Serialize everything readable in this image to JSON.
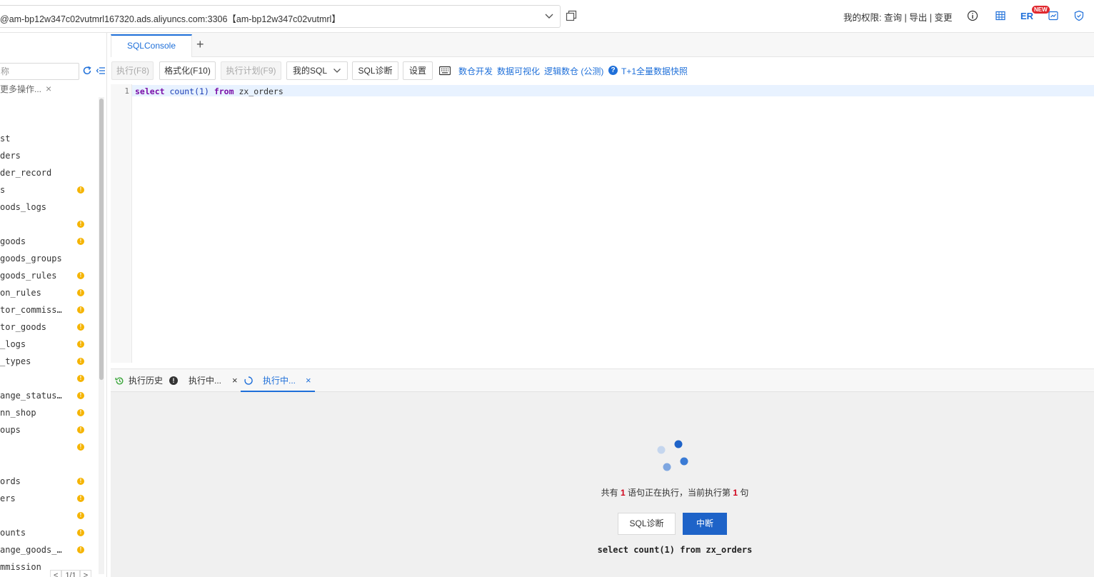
{
  "topbar": {
    "connection": "@am-bp12w347c02vutmrl167320.ads.aliyuncs.com:3306【am-bp12w347c02vutmrl】",
    "permissions_label": "我的权限:",
    "perm_query": "查询",
    "perm_export": "导出",
    "perm_change": "变更",
    "sep": "|",
    "er_label": "ER",
    "new_badge": "NEW"
  },
  "sidebar": {
    "search_placeholder": "称",
    "more_ops": "更多操作...",
    "close": "×",
    "tables": [
      {
        "name": "st",
        "warn": false
      },
      {
        "name": "ders",
        "warn": false
      },
      {
        "name": "der_record",
        "warn": false
      },
      {
        "name": "s",
        "warn": true
      },
      {
        "name": "oods_logs",
        "warn": false
      },
      {
        "name": "",
        "warn": true
      },
      {
        "name": "goods",
        "warn": true
      },
      {
        "name": "goods_groups",
        "warn": false
      },
      {
        "name": "goods_rules",
        "warn": true
      },
      {
        "name": "on_rules",
        "warn": true
      },
      {
        "name": "tor_commiss…",
        "warn": true
      },
      {
        "name": "tor_goods",
        "warn": true
      },
      {
        "name": "_logs",
        "warn": true
      },
      {
        "name": "_types",
        "warn": true
      },
      {
        "name": "",
        "warn": true
      },
      {
        "name": "ange_status…",
        "warn": true
      },
      {
        "name": "nn_shop",
        "warn": true
      },
      {
        "name": "oups",
        "warn": true
      },
      {
        "name": "",
        "warn": true
      },
      {
        "name": "",
        "warn": false
      },
      {
        "name": "ords",
        "warn": true
      },
      {
        "name": "ers",
        "warn": true
      },
      {
        "name": "",
        "warn": true
      },
      {
        "name": "ounts",
        "warn": true
      },
      {
        "name": "ange_goods_…",
        "warn": true
      },
      {
        "name": "mmission",
        "warn": false
      }
    ],
    "pager": {
      "prev": "<",
      "page": "1/1",
      "next": ">"
    }
  },
  "tabs": {
    "sql_console": "SQLConsole",
    "add": "+"
  },
  "toolbar": {
    "execute": "执行(F8)",
    "format": "格式化(F10)",
    "plan": "执行计划(F9)",
    "my_sql": "我的SQL",
    "diagnose": "SQL诊断",
    "settings": "设置",
    "link_dw": "数仓开发",
    "link_vis": "数据可视化",
    "link_logic": "逻辑数仓 (公测)",
    "link_snapshot": "T+1全量数据快照"
  },
  "editor": {
    "line_number": "1",
    "kw_select": "select",
    "fn_count": "count(1)",
    "kw_from": "from",
    "table": "zx_orders"
  },
  "results": {
    "history_tab": "执行历史",
    "history_alert": "!",
    "running_tab_1": "执行中...",
    "running_tab_2": "执行中...",
    "close": "×",
    "status_prefix": "共有",
    "status_count": "1",
    "status_mid": "语句正在执行，当前执行第",
    "status_current": "1",
    "status_suffix": "句",
    "btn_diagnose": "SQL诊断",
    "btn_abort": "中断",
    "sql_echo": "select count(1) from zx_orders"
  },
  "colors": {
    "accent": "#1e6fd9",
    "warn": "#f5b400",
    "abort_bg": "#1e63c8",
    "badge": "#e0282e"
  }
}
